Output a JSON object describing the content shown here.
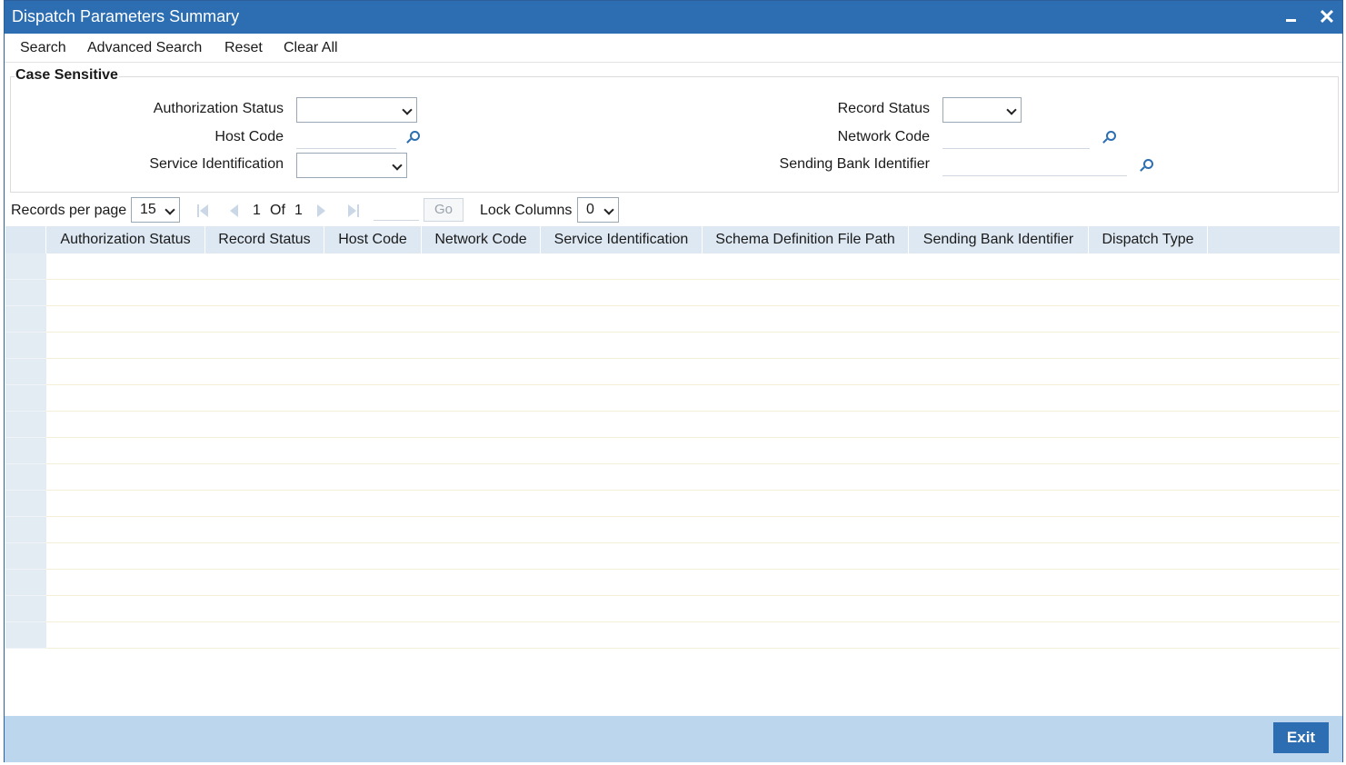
{
  "window": {
    "title": "Dispatch Parameters Summary"
  },
  "toolbar": {
    "search": "Search",
    "advanced_search": "Advanced Search",
    "reset": "Reset",
    "clear_all": "Clear All"
  },
  "criteria": {
    "legend": "Case Sensitive",
    "authorization_status": {
      "label": "Authorization Status",
      "value": ""
    },
    "host_code": {
      "label": "Host Code",
      "value": ""
    },
    "service_identification": {
      "label": "Service Identification",
      "value": ""
    },
    "record_status": {
      "label": "Record Status",
      "value": ""
    },
    "network_code": {
      "label": "Network Code",
      "value": ""
    },
    "sending_bank_identifier": {
      "label": "Sending Bank Identifier",
      "value": ""
    }
  },
  "pager": {
    "records_per_page_label": "Records per page",
    "records_per_page_value": "15",
    "current_page": "1",
    "of_label": "Of",
    "total_pages": "1",
    "go_label": "Go",
    "lock_columns_label": "Lock Columns",
    "lock_columns_value": "0"
  },
  "grid": {
    "columns": [
      "Authorization Status",
      "Record Status",
      "Host Code",
      "Network Code",
      "Service Identification",
      "Schema Definition File Path",
      "Sending Bank Identifier",
      "Dispatch Type"
    ],
    "row_count": 15
  },
  "footer": {
    "exit_label": "Exit"
  },
  "icons": {
    "minimize": "minimize-icon",
    "close": "close-icon",
    "lookup": "search-lookup-icon",
    "first": "first-page-icon",
    "prev": "prev-page-icon",
    "next": "next-page-icon",
    "last": "last-page-icon"
  },
  "colors": {
    "title_bar": "#2c6eb1",
    "grid_header": "#dde8f3",
    "footer": "#bcd6ee",
    "exit_button": "#2c6eb1"
  }
}
